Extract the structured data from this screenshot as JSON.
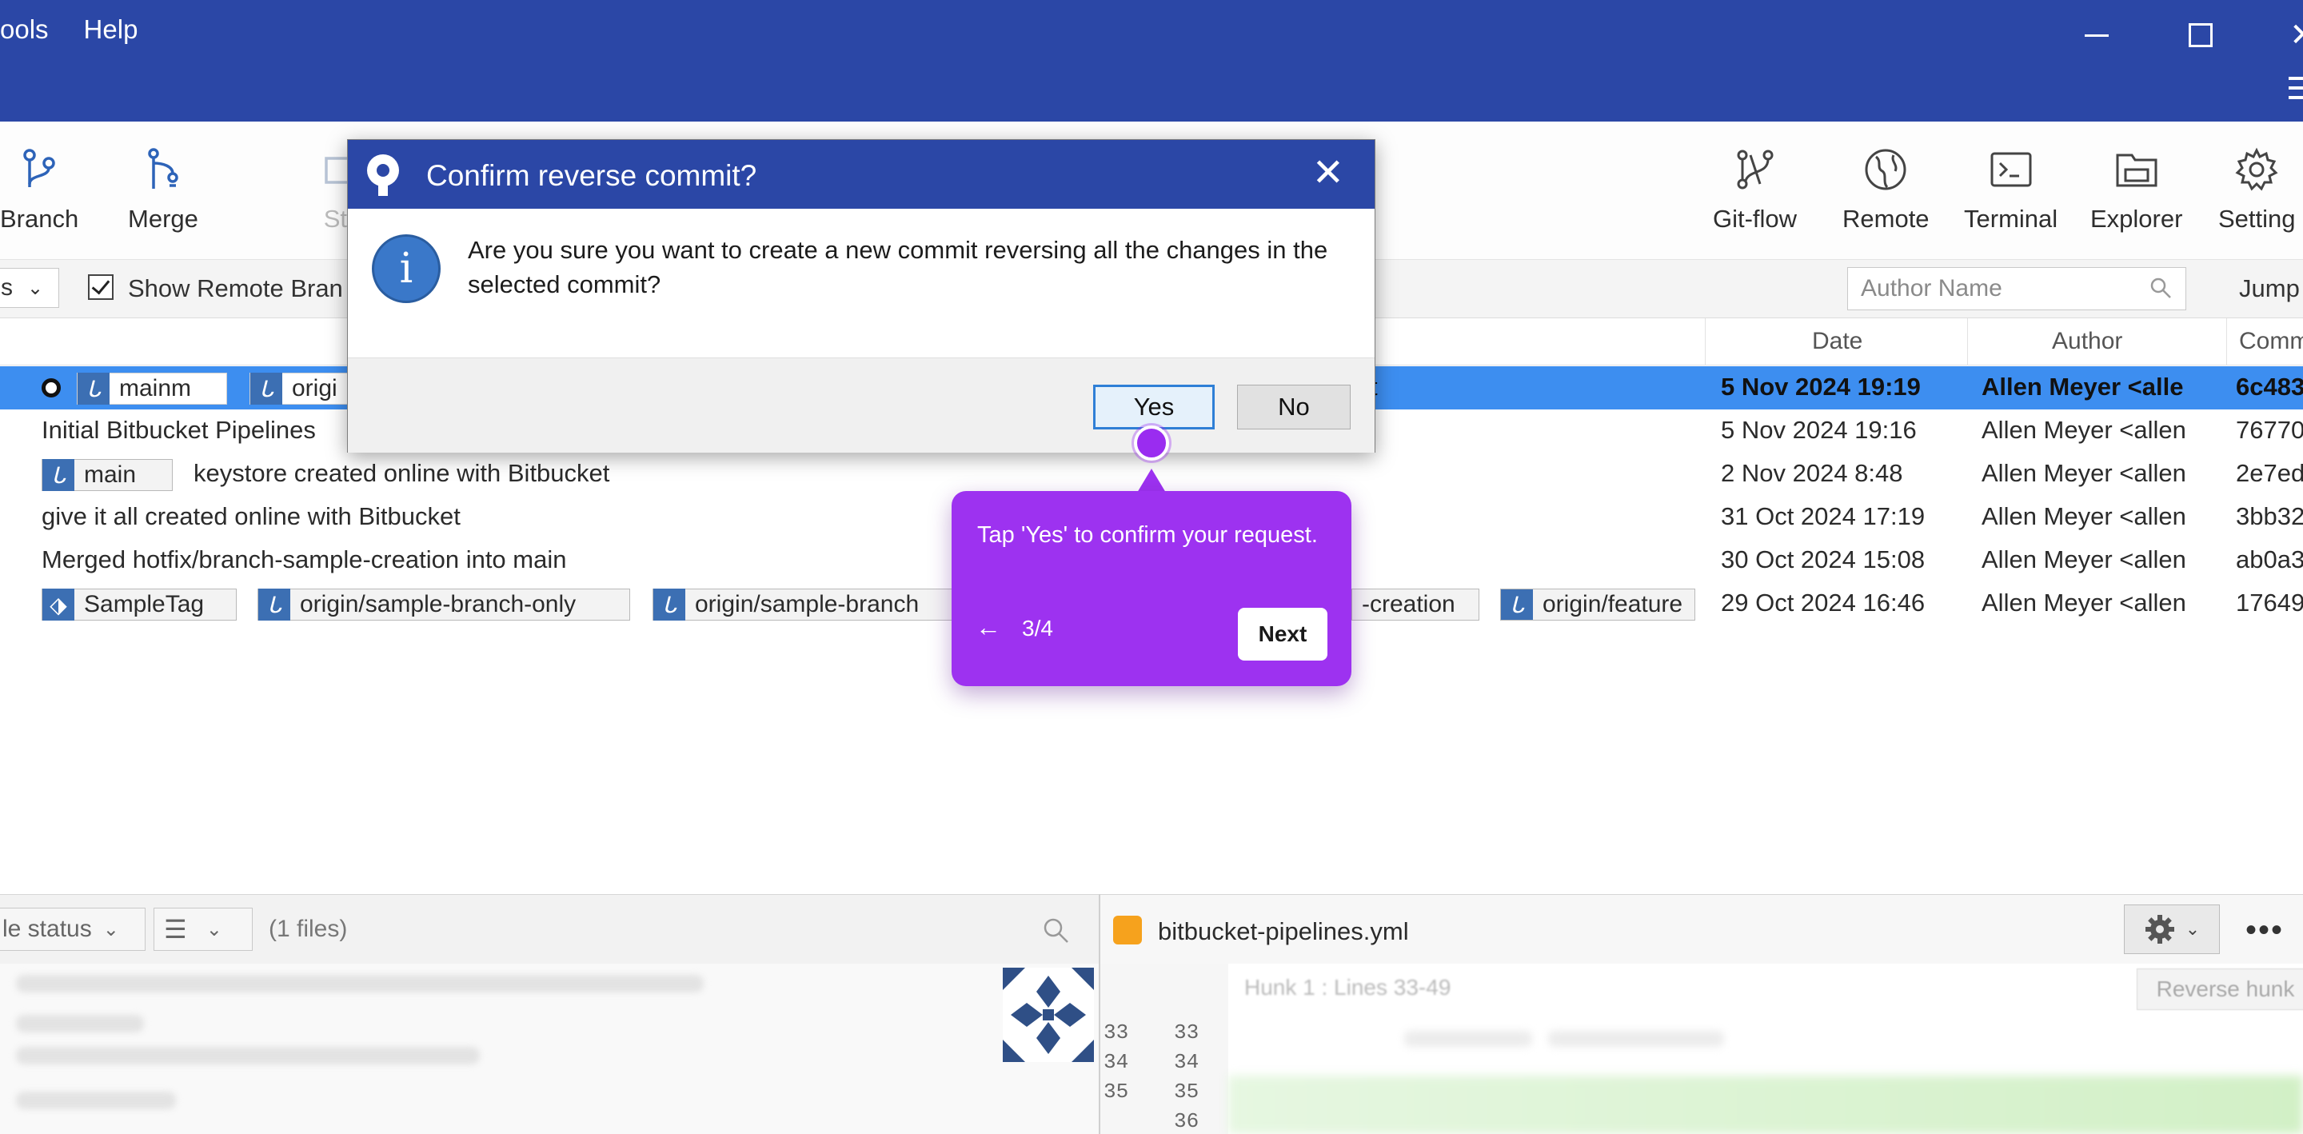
{
  "menu": {
    "items": [
      "ools",
      "Help"
    ]
  },
  "toolbar": {
    "left_tools": [
      {
        "label": "Branch",
        "icon": "branch-icon"
      },
      {
        "label": "Merge",
        "icon": "merge-icon"
      },
      {
        "label": "Sta",
        "icon": "stash-icon"
      }
    ],
    "right_tools": [
      {
        "label": "Git-flow",
        "icon": "git-flow-icon"
      },
      {
        "label": "Remote",
        "icon": "globe-icon"
      },
      {
        "label": "Terminal",
        "icon": "terminal-icon"
      },
      {
        "label": "Explorer",
        "icon": "folder-icon"
      },
      {
        "label": "Setting",
        "icon": "gear-icon"
      }
    ]
  },
  "filter": {
    "branch_dropdown": "s",
    "show_remote_label": "Show Remote Bran",
    "author_placeholder": "Author Name",
    "jump_label": "Jump"
  },
  "columns": {
    "date": "Date",
    "author": "Author",
    "commit": "Commi"
  },
  "commits": [
    {
      "tags": [
        "mainm",
        "origi"
      ],
      "message": "t",
      "date": "5 Nov 2024 19:19",
      "author": "Allen Meyer <alle",
      "hash": "6c483"
    },
    {
      "tags": [],
      "message": "Initial Bitbucket Pipelines",
      "date": "5 Nov 2024 19:16",
      "author": "Allen Meyer <allen",
      "hash": "76770"
    },
    {
      "tags": [
        "main"
      ],
      "message": "keystore created online with Bitbucket",
      "date": "2 Nov 2024 8:48",
      "author": "Allen Meyer <allen",
      "hash": "2e7ed"
    },
    {
      "tags": [],
      "message": "give it all created online with Bitbucket",
      "date": "31 Oct 2024 17:19",
      "author": "Allen Meyer <allen",
      "hash": "3bb32"
    },
    {
      "tags": [],
      "message": "Merged hotfix/branch-sample-creation into main",
      "date": "30 Oct 2024 15:08",
      "author": "Allen Meyer <allen",
      "hash": "ab0a3"
    },
    {
      "tags": [
        "SampleTag",
        "origin/sample-branch-only",
        "origin/sample-branch",
        "-creation",
        "origin/feature"
      ],
      "message": "",
      "date": "29 Oct 2024 16:46",
      "author": "Allen Meyer <allen",
      "hash": "17649"
    }
  ],
  "bottom_left": {
    "status_dropdown": "le status",
    "files_count": "(1 files)"
  },
  "bottom_right": {
    "file_name": "bitbucket-pipelines.yml",
    "hunk_label": "Hunk 1 : Lines 33-49",
    "reverse_hunk": "Reverse hunk",
    "old_lines": [
      "33",
      "34",
      "35"
    ],
    "new_lines": [
      "33",
      "34",
      "35",
      "36"
    ],
    "more": "•••"
  },
  "dialog": {
    "title": "Confirm reverse commit?",
    "message": "Are you sure you want to create a new commit reversing all the changes in the selected commit?",
    "yes": "Yes",
    "no": "No",
    "close": "✕"
  },
  "tour": {
    "text": "Tap 'Yes' to confirm your request.",
    "step": "3/4",
    "back": "←",
    "next": "Next"
  },
  "colors": {
    "title_bar": "#2b47a6",
    "selection": "#3d8ef0",
    "tour": "#9d32f0",
    "tag_icon": "#3c6fb3"
  }
}
